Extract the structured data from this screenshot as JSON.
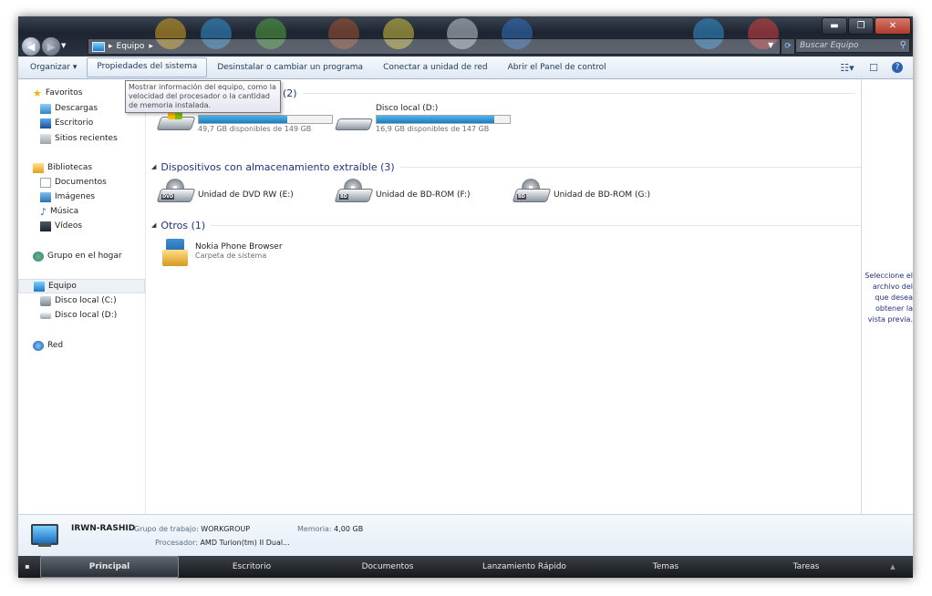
{
  "address": {
    "crumb": "Equipo",
    "search_placeholder": "Buscar Equipo"
  },
  "toolbar": {
    "organize": "Organizar",
    "commands": [
      "Propiedades del sistema",
      "Desinstalar o cambiar un programa",
      "Conectar a unidad de red",
      "Abrir el Panel de control"
    ]
  },
  "tooltip": {
    "text": "Mostrar información del equipo, como la velocidad del procesador o la cantidad de memoria instalada."
  },
  "sidebar": {
    "favorites": "Favoritos",
    "favorites_items": [
      "Descargas",
      "Escritorio",
      "Sitios recientes"
    ],
    "libraries": "Bibliotecas",
    "libraries_items": [
      "Documentos",
      "Imágenes",
      "Música",
      "Vídeos"
    ],
    "homegroup": "Grupo en el hogar",
    "computer": "Equipo",
    "computer_items": [
      "Disco local (C:)",
      "Disco local (D:)"
    ],
    "network": "Red"
  },
  "groups": {
    "hdd_header": "(2)",
    "removable_header": "Dispositivos con almacenamiento extraíble (3)",
    "others_header": "Otros (1)"
  },
  "drives": {
    "c": {
      "free": "49,7 GB disponibles de 149 GB",
      "used_fraction": 0.667
    },
    "d": {
      "label": "Disco local (D:)",
      "free": "16,9 GB disponibles de 147 GB",
      "used_fraction": 0.885
    },
    "removable": [
      {
        "label": "Unidad de DVD RW (E:)",
        "badge": "DVD"
      },
      {
        "label": "Unidad de BD-ROM (F:)",
        "badge": "BD"
      },
      {
        "label": "Unidad de BD-ROM (G:)",
        "badge": "BD"
      }
    ],
    "other": {
      "label": "Nokia Phone Browser",
      "sub": "Carpeta de sistema"
    }
  },
  "preview": {
    "text": "Seleccione el archivo del que desea obtener la vista previa."
  },
  "details": {
    "name": "IRWN-RASHID",
    "workgroup_label": "Grupo de trabajo:",
    "workgroup": "WORKGROUP",
    "memory_label": "Memoria:",
    "memory": "4,00 GB",
    "cpu_label": "Procesador:",
    "cpu": "AMD Turion(tm) II Dual..."
  },
  "taskbar": {
    "items": [
      "Principal",
      "Escritorio",
      "Documentos",
      "Lanzamiento Rápido",
      "Temas",
      "Tareas"
    ]
  },
  "colors": {
    "accent": "#1e3287",
    "bar_fill": "#1a7cc4",
    "taskbar": "#15181c"
  }
}
